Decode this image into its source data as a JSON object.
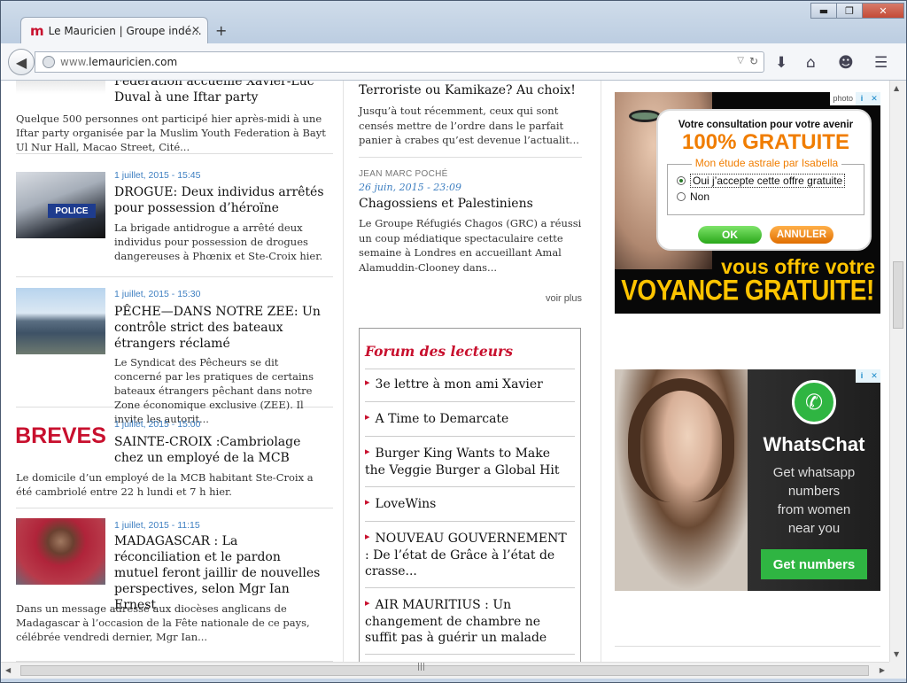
{
  "browser": {
    "tab_title": "Le Mauricien | Groupe indé...",
    "favicon_letter": "m",
    "tab_close": "✕",
    "new_tab": "+",
    "url_prefix": "www.",
    "url_domain": "lemauricien.com",
    "window_buttons": {
      "minimize": "▬",
      "maximize": "❐",
      "close": "✕"
    }
  },
  "left_articles": [
    {
      "meta": "",
      "headline": "Fédération accueille Xavier-Luc Duval à une Iftar party",
      "summary": "Quelque 500 personnes ont participé hier après-midi à une Iftar party organisée par la Muslim Youth Federation à Bayt Ul Nur Hall, Macao Street, Cité..."
    },
    {
      "meta": "1 juillet, 2015 - 15:45",
      "headline": "DROGUE: Deux individus arrêtés pour possession d’héroïne",
      "summary": "La brigade antidrogue a arrêté deux individus pour possession de drogues dangereuses à Phœnix et Ste-Croix hier.",
      "thumb_label": "POLICE"
    },
    {
      "meta": "1 juillet, 2015 - 15:30",
      "headline": "PÊCHE—DANS NOTRE ZEE: Un contrôle strict des bateaux étrangers réclamé",
      "summary": "Le Syndicat des Pêcheurs se dit concerné par les pratiques de certains bateaux étrangers pêchant dans notre Zone économique exclusive (ZEE). Il invite les autorit..."
    },
    {
      "meta": "1 juillet, 2015 - 15:00",
      "headline": "SAINTE-CROIX :Cambriolage chez un employé de la MCB",
      "summary": "Le domicile d’un employé de la MCB habitant Ste-Croix a été cambriolé entre 22 h lundi et 7 h hier.",
      "thumb_label": "BREVES"
    },
    {
      "meta": "1 juillet, 2015 - 11:15",
      "headline": "MADAGASCAR : La réconciliation et le pardon mutuel feront jaillir de nouvelles perspectives, selon Mgr Ian Ernest",
      "summary": "Dans un message adressé aux diocèses anglicans de Madagascar à l’occasion de la Fête nationale de ce pays, célébrée vendredi dernier, Mgr Ian..."
    }
  ],
  "mid_articles": [
    {
      "author": "",
      "date": "",
      "title": "Terroriste ou Kamikaze? Au choix!",
      "text": "Jusqu’à tout récemment, ceux qui sont censés mettre de l’ordre dans le parfait panier à crabes qu’est devenue l’actualit..."
    },
    {
      "author": "JEAN MARC POCHÉ",
      "date": "26 juin, 2015 - 23:09",
      "title": "Chagossiens et Palestiniens",
      "text": "Le Groupe Réfugiés Chagos (GRC) a réussi un coup médiatique spectaculaire cette semaine à Londres en accueillant Amal Alamuddin-Clooney dans..."
    }
  ],
  "voir_plus": "voir plus",
  "forum": {
    "title": "Forum des lecteurs",
    "items": [
      "3e lettre à mon ami Xavier",
      "A Time to Demarcate",
      "Burger King Wants to Make the Veggie Burger a Global Hit",
      "LoveWins",
      "NOUVEAU GOUVERNEMENT : De l’état de Grâce à l’état de crasse...",
      "AIR MAURITIUS : Un changement de chambre ne suffit pas à guérir un malade"
    ]
  },
  "ad1": {
    "badge": "photo",
    "dialog_title": "Votre consultation pour votre avenir",
    "big": "100% GRATUITE",
    "legend": "Mon étude astrale par Isabella",
    "option_yes": "Oui j’accepte cette offre gratuite",
    "option_no": "Non",
    "ok": "OK",
    "cancel": "ANNULER",
    "line1": "vous offre votre",
    "line2": "VOYANCE GRATUITE!"
  },
  "ad2": {
    "title": "WhatsChat",
    "text_lines": [
      "Get whatsapp",
      "numbers",
      "from women",
      "near you"
    ],
    "button": "Get numbers"
  },
  "ad_choices": {
    "info": "i",
    "close": "✕"
  }
}
